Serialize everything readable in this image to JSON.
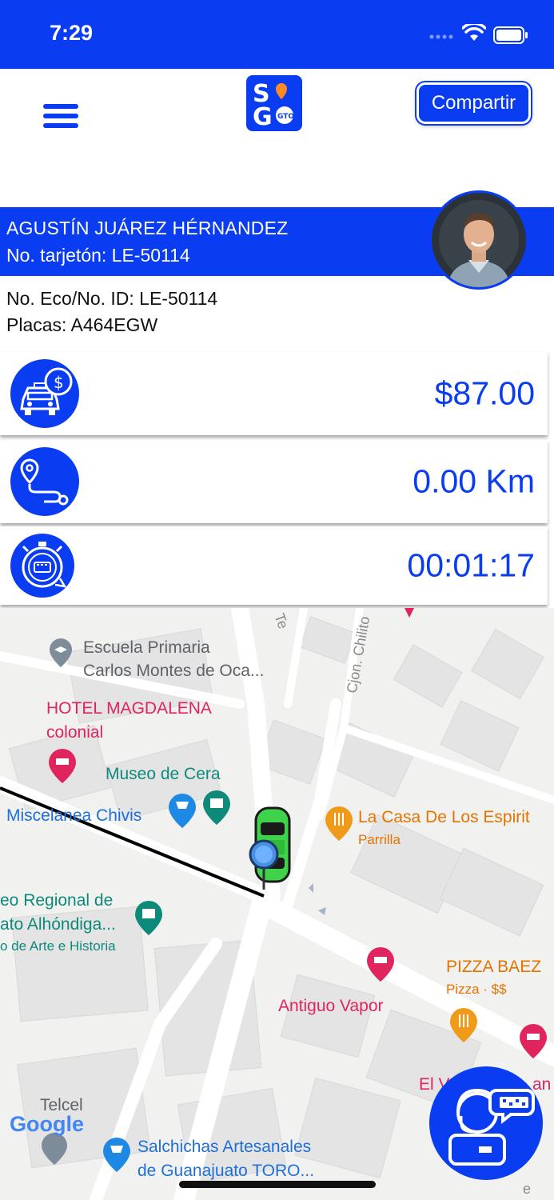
{
  "status_bar": {
    "time": "7:29"
  },
  "header": {
    "share_label": "Compartir",
    "logo_letters": "SIGO GTO"
  },
  "driver": {
    "name": "AGUSTÍN JUÁREZ HÉRNANDEZ",
    "card_number": "No. tarjetón: LE-50114",
    "eco_id": "No. Eco/No. ID: LE-50114",
    "plates": "Placas: A464EGW"
  },
  "stats": {
    "fare": "$87.00",
    "distance": "0.00 Km",
    "elapsed": "00:01:17"
  },
  "map": {
    "labels": {
      "escuela_1": "Escuela Primaria",
      "escuela_2": "Carlos Montes de Oca...",
      "hotel_1": "HOTEL MAGDALENA",
      "hotel_2": "colonial",
      "museo_cera": "Museo de Cera",
      "miscelanea": "Miscelanea Chivis",
      "casa_espiritus": "La Casa De Los Espirit",
      "parrilla": "Parrilla",
      "museo_regional_1": "eo Regional de",
      "museo_regional_2": "ato Alhóndiga...",
      "arte_historia": "o de Arte e Historia",
      "pizza": "PIZZA BAEZ",
      "pizza_sub": "Pizza · $$",
      "antiguo_vapor": "Antiguo Vapor",
      "telcel": "Telcel",
      "salchichas_1": "Salchichas Artesanales",
      "salchichas_2": "de Guanajuato TORO...",
      "street_te": "Te",
      "street_chilito": "Cjon. Chilito",
      "el_v": "El V",
      "an": "an",
      "edge_e": "e"
    },
    "attribution": "Google"
  },
  "colors": {
    "brand_blue": "#0a3cf2",
    "poi_pink": "#e0245e",
    "poi_teal": "#0d8a7a",
    "poi_orange": "#e37400"
  }
}
